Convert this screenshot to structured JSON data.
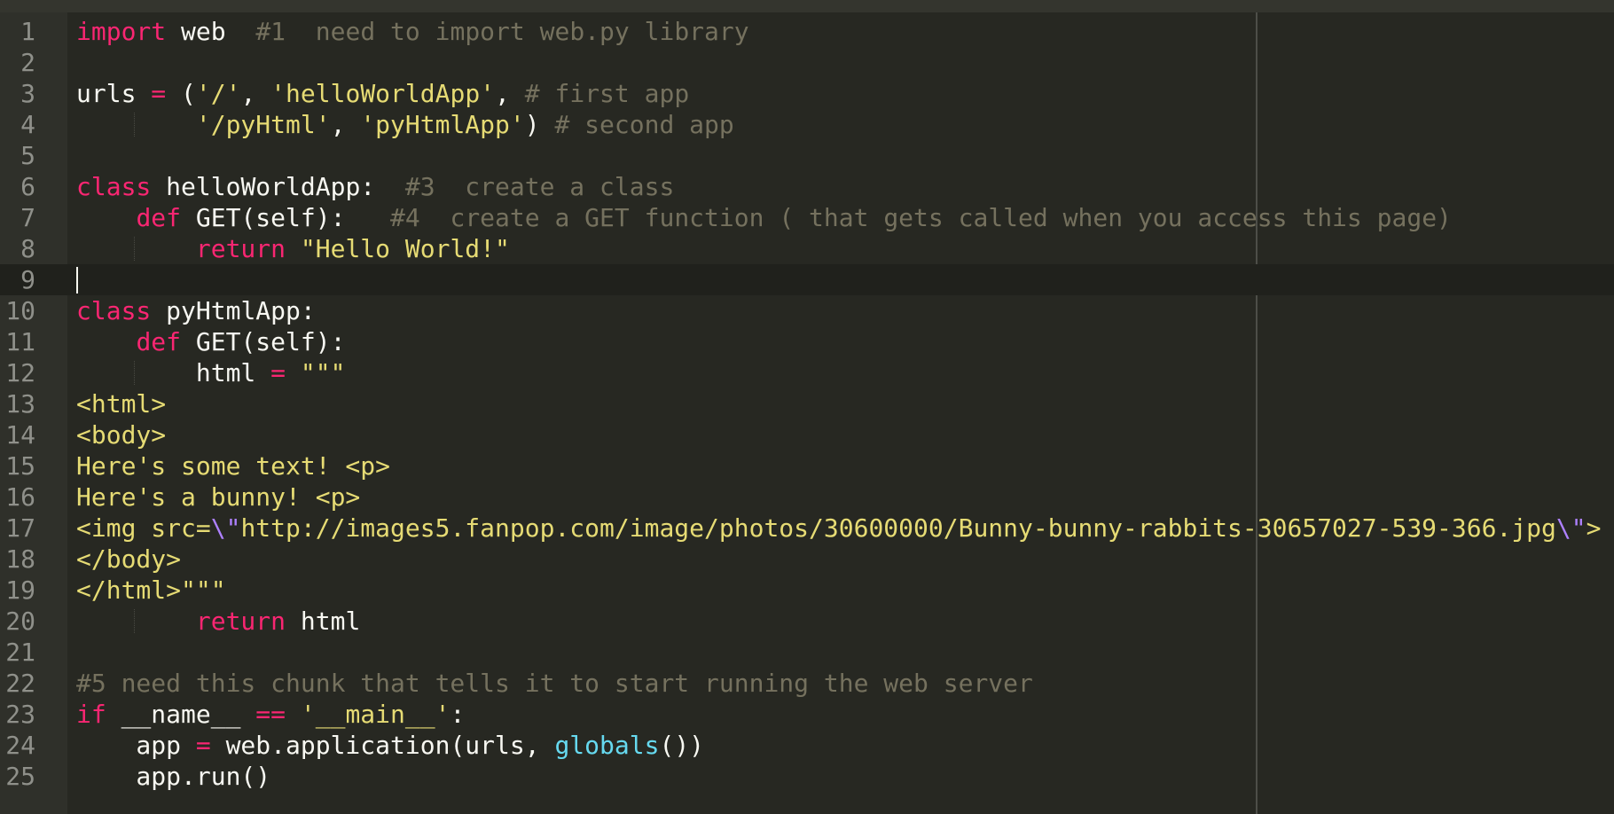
{
  "editor": {
    "lines": [
      {
        "n": "1",
        "tokens": [
          {
            "t": "import",
            "c": "kw"
          },
          {
            "t": " web  ",
            "c": "cl"
          },
          {
            "t": "#1  need to import web.py library",
            "c": "cm"
          }
        ]
      },
      {
        "n": "2",
        "tokens": []
      },
      {
        "n": "3",
        "tokens": [
          {
            "t": "urls ",
            "c": "cl"
          },
          {
            "t": "=",
            "c": "op"
          },
          {
            "t": " (",
            "c": "cl"
          },
          {
            "t": "'/'",
            "c": "str"
          },
          {
            "t": ", ",
            "c": "cl"
          },
          {
            "t": "'helloWorldApp'",
            "c": "str"
          },
          {
            "t": ", ",
            "c": "cl"
          },
          {
            "t": "# first app",
            "c": "cm"
          }
        ]
      },
      {
        "n": "4",
        "guide": true,
        "tokens": [
          {
            "t": "        ",
            "c": "cl"
          },
          {
            "t": "'/pyHtml'",
            "c": "str"
          },
          {
            "t": ", ",
            "c": "cl"
          },
          {
            "t": "'pyHtmlApp'",
            "c": "str"
          },
          {
            "t": ") ",
            "c": "cl"
          },
          {
            "t": "# second app",
            "c": "cm"
          }
        ]
      },
      {
        "n": "5",
        "tokens": []
      },
      {
        "n": "6",
        "tokens": [
          {
            "t": "class",
            "c": "kw"
          },
          {
            "t": " helloWorldApp:  ",
            "c": "cl"
          },
          {
            "t": "#3  create a class",
            "c": "cm"
          }
        ]
      },
      {
        "n": "7",
        "tokens": [
          {
            "t": "    ",
            "c": "cl"
          },
          {
            "t": "def",
            "c": "kw"
          },
          {
            "t": " GET(self):   ",
            "c": "cl"
          },
          {
            "t": "#4  create a GET function ( that gets called when you access this page)",
            "c": "cm"
          }
        ]
      },
      {
        "n": "8",
        "guide": true,
        "tokens": [
          {
            "t": "        ",
            "c": "cl"
          },
          {
            "t": "return",
            "c": "kw"
          },
          {
            "t": " ",
            "c": "cl"
          },
          {
            "t": "\"Hello World!\"",
            "c": "str"
          }
        ]
      },
      {
        "n": "9",
        "current": true,
        "cursor": true,
        "tokens": []
      },
      {
        "n": "10",
        "tokens": [
          {
            "t": "class",
            "c": "kw"
          },
          {
            "t": " pyHtmlApp:",
            "c": "cl"
          }
        ]
      },
      {
        "n": "11",
        "tokens": [
          {
            "t": "    ",
            "c": "cl"
          },
          {
            "t": "def",
            "c": "kw"
          },
          {
            "t": " GET(self):",
            "c": "cl"
          }
        ]
      },
      {
        "n": "12",
        "guide": true,
        "tokens": [
          {
            "t": "        html ",
            "c": "cl"
          },
          {
            "t": "=",
            "c": "op"
          },
          {
            "t": " ",
            "c": "cl"
          },
          {
            "t": "\"\"\"",
            "c": "str"
          }
        ]
      },
      {
        "n": "13",
        "tokens": [
          {
            "t": "<html>",
            "c": "str"
          }
        ]
      },
      {
        "n": "14",
        "tokens": [
          {
            "t": "<body>",
            "c": "str"
          }
        ]
      },
      {
        "n": "15",
        "tokens": [
          {
            "t": "Here's some text! <p>",
            "c": "str"
          }
        ]
      },
      {
        "n": "16",
        "tokens": [
          {
            "t": "Here's a bunny! <p>",
            "c": "str"
          }
        ]
      },
      {
        "n": "17",
        "tokens": [
          {
            "t": "<img src=",
            "c": "str"
          },
          {
            "t": "\\\"",
            "c": "esc"
          },
          {
            "t": "http://images5.fanpop.com/image/photos/30600000/Bunny-bunny-rabbits-30657027-539-366.jpg",
            "c": "str"
          },
          {
            "t": "\\\"",
            "c": "esc"
          },
          {
            "t": ">",
            "c": "str"
          }
        ]
      },
      {
        "n": "18",
        "tokens": [
          {
            "t": "</body>",
            "c": "str"
          }
        ]
      },
      {
        "n": "19",
        "tokens": [
          {
            "t": "</html>\"\"\"",
            "c": "str"
          }
        ]
      },
      {
        "n": "20",
        "guide": true,
        "tokens": [
          {
            "t": "        ",
            "c": "cl"
          },
          {
            "t": "return",
            "c": "kw"
          },
          {
            "t": " html",
            "c": "cl"
          }
        ]
      },
      {
        "n": "21",
        "tokens": []
      },
      {
        "n": "22",
        "tokens": [
          {
            "t": "#5 need this chunk that tells it to start running the web server",
            "c": "cm"
          }
        ]
      },
      {
        "n": "23",
        "tokens": [
          {
            "t": "if",
            "c": "kw"
          },
          {
            "t": " __name__ ",
            "c": "cl"
          },
          {
            "t": "==",
            "c": "op"
          },
          {
            "t": " ",
            "c": "cl"
          },
          {
            "t": "'__main__'",
            "c": "str"
          },
          {
            "t": ":",
            "c": "cl"
          }
        ]
      },
      {
        "n": "24",
        "tokens": [
          {
            "t": "    app ",
            "c": "cl"
          },
          {
            "t": "=",
            "c": "op"
          },
          {
            "t": " web.application(urls, ",
            "c": "cl"
          },
          {
            "t": "globals",
            "c": "bi"
          },
          {
            "t": "())",
            "c": "cl"
          }
        ]
      },
      {
        "n": "25",
        "tokens": [
          {
            "t": "    app.run()",
            "c": "cl"
          }
        ]
      }
    ]
  },
  "colors": {
    "background": "#272822",
    "gutter": "#2f302a",
    "keyword": "#f92672",
    "string": "#e6db74",
    "comment": "#75715e",
    "builtin": "#66d9ef",
    "escape": "#ae81ff",
    "text": "#f8f8f2"
  }
}
